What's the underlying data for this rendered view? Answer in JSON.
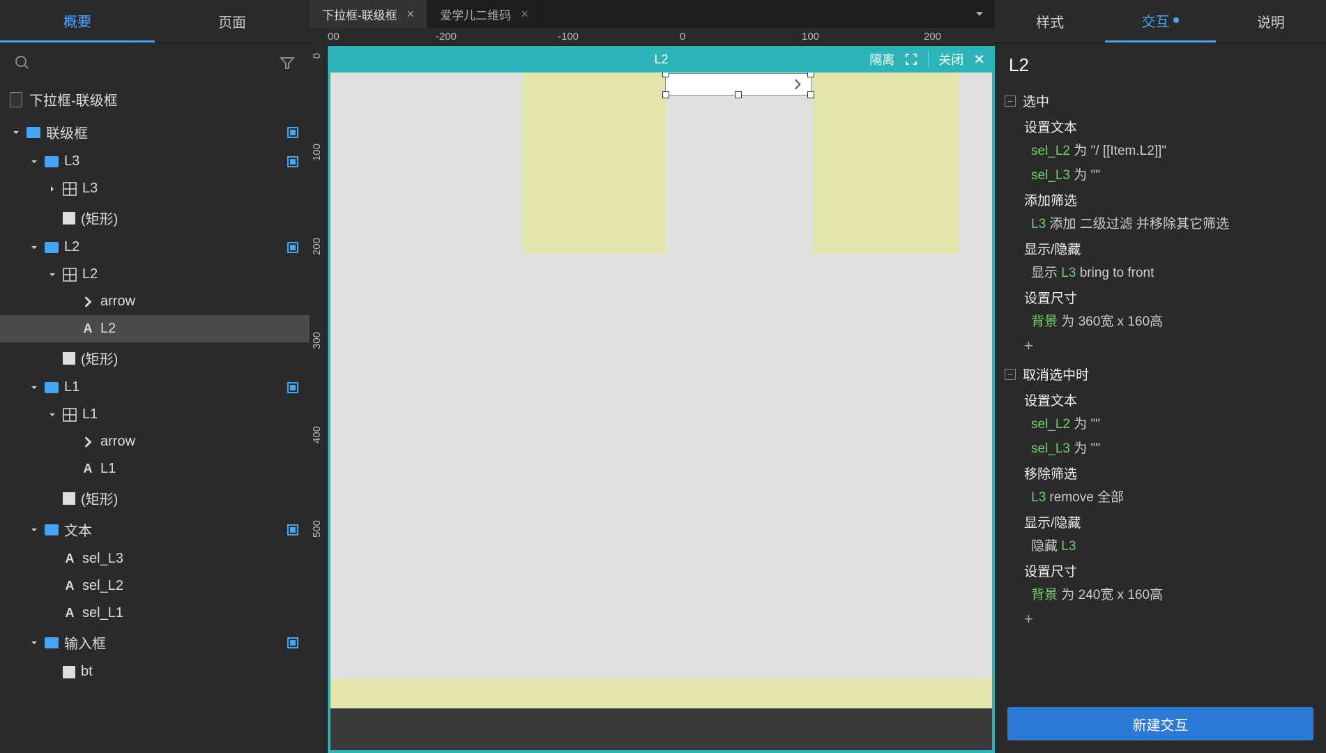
{
  "leftTabs": {
    "outline": "概要",
    "pages": "页面"
  },
  "pageTitle": "下拉框-联级框",
  "docTabs": [
    {
      "label": "下拉框-联级框",
      "active": true
    },
    {
      "label": "爱学儿二维码",
      "active": false
    }
  ],
  "rulerH": [
    "00",
    "-200",
    "-100",
    "0",
    "100",
    "200"
  ],
  "rulerV": [
    "0",
    "100",
    "200",
    "300",
    "400",
    "500"
  ],
  "isoBar": {
    "title": "L2",
    "isolate": "隔离",
    "close": "关闭"
  },
  "tree": [
    {
      "lvl": 0,
      "type": "folder",
      "label": "联级框",
      "caret": "down",
      "target": true
    },
    {
      "lvl": 1,
      "type": "folder",
      "label": "L3",
      "caret": "down",
      "target": true
    },
    {
      "lvl": 2,
      "type": "repeater",
      "label": "L3",
      "caret": "right"
    },
    {
      "lvl": 2,
      "type": "rect",
      "label": "(矩形)"
    },
    {
      "lvl": 1,
      "type": "folder",
      "label": "L2",
      "caret": "down",
      "target": true
    },
    {
      "lvl": 2,
      "type": "repeater",
      "label": "L2",
      "caret": "down"
    },
    {
      "lvl": 3,
      "type": "arrow",
      "label": "arrow"
    },
    {
      "lvl": 3,
      "type": "text",
      "label": "L2",
      "selected": true
    },
    {
      "lvl": 2,
      "type": "rect",
      "label": "(矩形)"
    },
    {
      "lvl": 1,
      "type": "folder",
      "label": "L1",
      "caret": "down",
      "target": true
    },
    {
      "lvl": 2,
      "type": "repeater",
      "label": "L1",
      "caret": "down"
    },
    {
      "lvl": 3,
      "type": "arrow",
      "label": "arrow"
    },
    {
      "lvl": 3,
      "type": "text",
      "label": "L1"
    },
    {
      "lvl": 2,
      "type": "rect",
      "label": "(矩形)"
    },
    {
      "lvl": 1,
      "type": "folder",
      "label": "文本",
      "caret": "down",
      "target": true
    },
    {
      "lvl": 2,
      "type": "text",
      "label": "sel_L3"
    },
    {
      "lvl": 2,
      "type": "text",
      "label": "sel_L2"
    },
    {
      "lvl": 2,
      "type": "text",
      "label": "sel_L1"
    },
    {
      "lvl": 1,
      "type": "folder",
      "label": "输入框",
      "caret": "down",
      "target": true
    },
    {
      "lvl": 2,
      "type": "rect",
      "label": "bt"
    }
  ],
  "rightTabs": {
    "style": "样式",
    "interact": "交互",
    "notes": "说明"
  },
  "selectionName": "L2",
  "ix": [
    {
      "event": "选中",
      "actions": [
        {
          "title": "设置文本",
          "details": [
            {
              "pre": "",
              "g": "sel_L2",
              "post": " 为 \"/ [[Item.L2]]\""
            },
            {
              "pre": "",
              "g": "sel_L3",
              "post": " 为 \"\""
            }
          ]
        },
        {
          "title": "添加筛选",
          "details": [
            {
              "pre": "",
              "g": "L3",
              "post": " 添加 二级过滤 并移除其它筛选"
            }
          ]
        },
        {
          "title": "显示/隐藏",
          "details": [
            {
              "pre": "显示 ",
              "g": "L3",
              "post": "  bring to front"
            }
          ]
        },
        {
          "title": "设置尺寸",
          "details": [
            {
              "pre": "",
              "g": "背景",
              "post": " 为 360宽 x 160高"
            }
          ]
        }
      ]
    },
    {
      "event": "取消选中时",
      "actions": [
        {
          "title": "设置文本",
          "details": [
            {
              "pre": "",
              "g": "sel_L2",
              "post": " 为 \"\""
            },
            {
              "pre": "",
              "g": "sel_L3",
              "post": " 为 \"\""
            }
          ]
        },
        {
          "title": "移除筛选",
          "details": [
            {
              "pre": "",
              "g": "L3",
              "post": " remove 全部"
            }
          ]
        },
        {
          "title": "显示/隐藏",
          "details": [
            {
              "pre": "隐藏 ",
              "g": "L3",
              "post": ""
            }
          ]
        },
        {
          "title": "设置尺寸",
          "details": [
            {
              "pre": "",
              "g": "背景",
              "post": " 为 240宽 x 160高"
            }
          ]
        }
      ]
    }
  ],
  "newIxBtn": "新建交互",
  "plus": "+"
}
